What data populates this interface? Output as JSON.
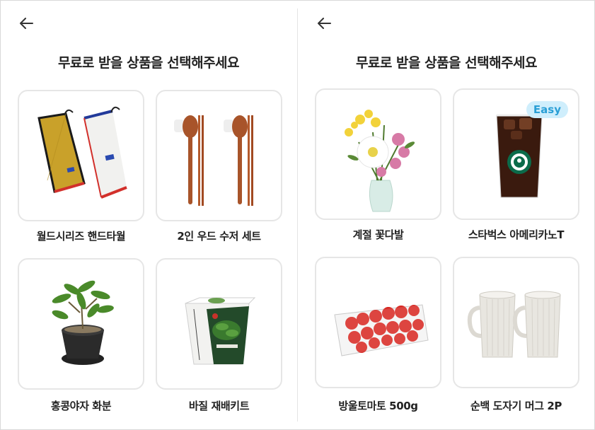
{
  "left_screen": {
    "title": "무료로 받을 상품을 선택해주세요",
    "products": [
      {
        "name": "월드시리즈 핸드타월",
        "image": "towels"
      },
      {
        "name": "2인 우드 수저 세트",
        "image": "spoon-chopsticks"
      },
      {
        "name": "홍콩야자 화분",
        "image": "potted-plant"
      },
      {
        "name": "바질 재배키트",
        "image": "basil-kit"
      }
    ]
  },
  "right_screen": {
    "title": "무료로 받을 상품을 선택해주세요",
    "products": [
      {
        "name": "계절 꽃다발",
        "image": "flower-bouquet"
      },
      {
        "name": "스타벅스 아메리카노T",
        "image": "iced-americano",
        "badge": "Easy"
      },
      {
        "name": "방울토마토 500g",
        "image": "cherry-tomatoes"
      },
      {
        "name": "순백 도자기 머그 2P",
        "image": "ceramic-mugs"
      }
    ]
  },
  "icons": {
    "back": "arrow-left-icon"
  },
  "colors": {
    "card_border": "#e6e6e6",
    "badge_bg": "#cfeefc",
    "badge_text": "#2a9fd6"
  }
}
